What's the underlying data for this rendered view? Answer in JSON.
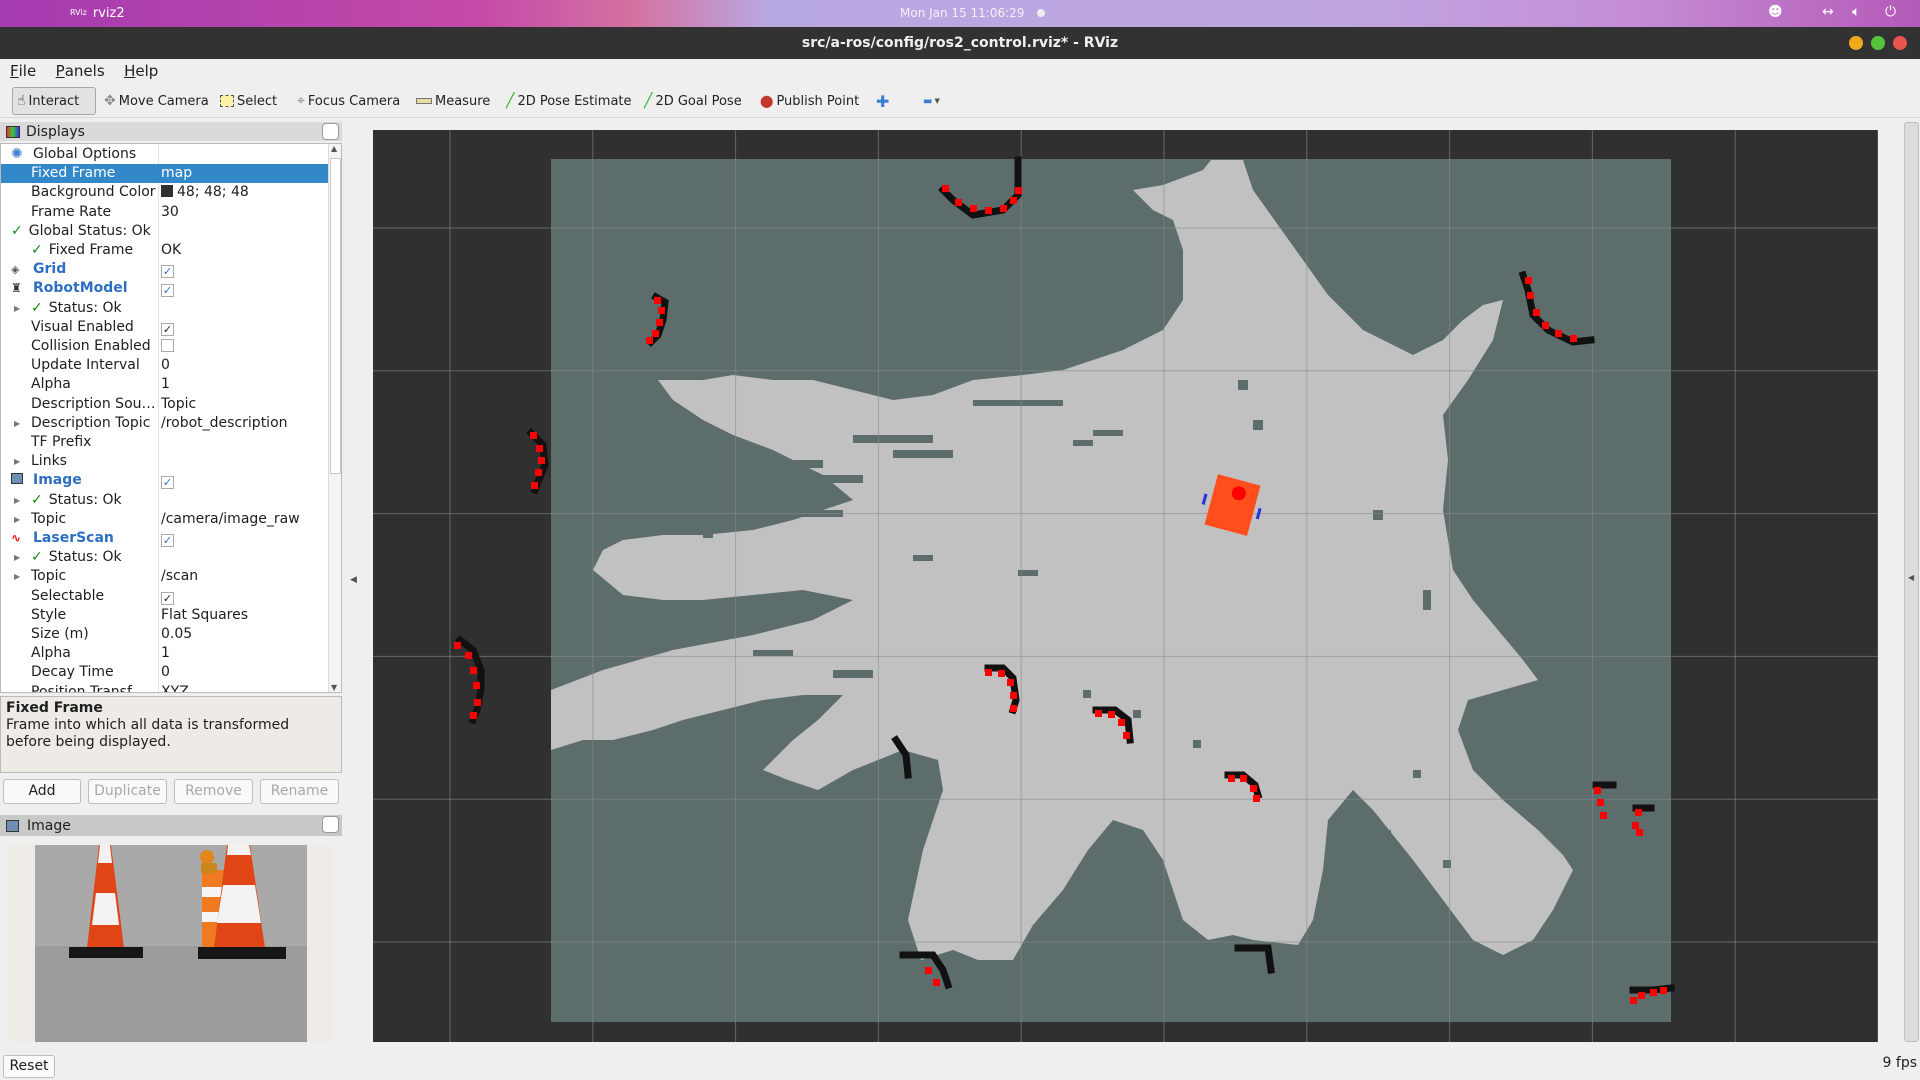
{
  "desktop": {
    "app_name": "rviz2",
    "app_badge": "RViz",
    "clock": "Mon Jan 15  11:06:29",
    "tray_icons": [
      "face-emoji-icon",
      "network-arrows-icon",
      "volume-icon",
      "power-icon"
    ]
  },
  "window": {
    "title": "src/a-ros/config/ros2_control.rviz* - RViz",
    "buttons": [
      {
        "name": "minimize",
        "color": "#f0a91c"
      },
      {
        "name": "maximize",
        "color": "#55c33a"
      },
      {
        "name": "close",
        "color": "#e9544c"
      }
    ]
  },
  "menu": [
    {
      "label": "File",
      "mnemonic": "F",
      "rest": "ile"
    },
    {
      "label": "Panels",
      "mnemonic": "P",
      "rest": "anels"
    },
    {
      "label": "Help",
      "mnemonic": "H",
      "rest": "elp"
    }
  ],
  "toolbar": [
    {
      "label": "Interact",
      "icon": "hand-pointer-icon",
      "glyph": "☝",
      "active": true
    },
    {
      "label": "Move Camera",
      "icon": "move-camera-icon",
      "glyph": "✥",
      "active": false
    },
    {
      "label": "Select",
      "icon": "select-rect-icon",
      "glyph": "▭",
      "active": false
    },
    {
      "label": "Focus Camera",
      "icon": "focus-camera-icon",
      "glyph": "⌖",
      "active": false
    },
    {
      "label": "Measure",
      "icon": "ruler-icon",
      "glyph": "▬",
      "active": false
    },
    {
      "label": "2D Pose Estimate",
      "icon": "pose-estimate-arrow-icon",
      "glyph": "╱",
      "active": false
    },
    {
      "label": "2D Goal Pose",
      "icon": "goal-pose-arrow-icon",
      "glyph": "╱",
      "active": false
    },
    {
      "label": "Publish Point",
      "icon": "map-pin-icon",
      "glyph": "●",
      "active": false
    },
    {
      "label": "",
      "icon": "add-tool-plus-icon",
      "glyph": "✚",
      "active": false
    },
    {
      "label": "",
      "icon": "remove-tool-minus-icon",
      "glyph": "▬",
      "active": false
    }
  ],
  "displays_panel": {
    "title": "Displays",
    "rows": [
      {
        "label": "Global Options",
        "value": "",
        "indent": 1,
        "icon": "gear-icon",
        "style": "plain"
      },
      {
        "label": "Fixed Frame",
        "value": "map",
        "indent": 2,
        "selected": true
      },
      {
        "label": "Background Color",
        "value": "48; 48; 48",
        "indent": 2,
        "swatch": "#303030"
      },
      {
        "label": "Frame Rate",
        "value": "30",
        "indent": 2
      },
      {
        "label": "Global Status: Ok",
        "value": "",
        "indent": 1,
        "check": true
      },
      {
        "label": "Fixed Frame",
        "value": "OK",
        "indent": 2,
        "check": true
      },
      {
        "label": "Grid",
        "value": "",
        "indent": 1,
        "icon": "grid-icon",
        "style": "blue",
        "checkbox": "checked-blue"
      },
      {
        "label": "RobotModel",
        "value": "",
        "indent": 1,
        "icon": "robot-model-icon",
        "style": "blue",
        "checkbox": "checked-blue"
      },
      {
        "label": "Status: Ok",
        "value": "",
        "indent": 2,
        "check": true,
        "expander": true
      },
      {
        "label": "Visual Enabled",
        "value": "",
        "indent": 2,
        "checkbox": "checked"
      },
      {
        "label": "Collision Enabled",
        "value": "",
        "indent": 2,
        "checkbox": "unchecked"
      },
      {
        "label": "Update Interval",
        "value": "0",
        "indent": 2
      },
      {
        "label": "Alpha",
        "value": "1",
        "indent": 2
      },
      {
        "label": "Description Sou…",
        "value": "Topic",
        "indent": 2
      },
      {
        "label": "Description Topic",
        "value": "/robot_description",
        "indent": 2,
        "expander": true
      },
      {
        "label": "TF Prefix",
        "value": "",
        "indent": 2
      },
      {
        "label": "Links",
        "value": "",
        "indent": 2,
        "expander": true
      },
      {
        "label": "Image",
        "value": "",
        "indent": 1,
        "icon": "image-icon",
        "style": "blue",
        "checkbox": "checked-blue"
      },
      {
        "label": "Status: Ok",
        "value": "",
        "indent": 2,
        "check": true,
        "expander": true
      },
      {
        "label": "Topic",
        "value": "/camera/image_raw",
        "indent": 2,
        "expander": true
      },
      {
        "label": "LaserScan",
        "value": "",
        "indent": 1,
        "icon": "laser-scan-icon",
        "style": "blue",
        "checkbox": "checked-blue"
      },
      {
        "label": "Status: Ok",
        "value": "",
        "indent": 2,
        "check": true,
        "expander": true
      },
      {
        "label": "Topic",
        "value": "/scan",
        "indent": 2,
        "expander": true
      },
      {
        "label": "Selectable",
        "value": "",
        "indent": 2,
        "checkbox": "checked"
      },
      {
        "label": "Style",
        "value": "Flat Squares",
        "indent": 2
      },
      {
        "label": "Size (m)",
        "value": "0.05",
        "indent": 2
      },
      {
        "label": "Alpha",
        "value": "1",
        "indent": 2
      },
      {
        "label": "Decay Time",
        "value": "0",
        "indent": 2
      },
      {
        "label": "Position Transf…",
        "value": "XYZ",
        "indent": 2
      }
    ],
    "description_title": "Fixed Frame",
    "description_text": "Frame into which all data is transformed before being displayed.",
    "buttons": {
      "add": "Add",
      "duplicate": "Duplicate",
      "remove": "Remove",
      "rename": "Rename"
    }
  },
  "image_panel": {
    "title": "Image",
    "reset_label": "Reset"
  },
  "view": {
    "fps": "9 fps",
    "background": "#303030",
    "map_unknown_color": "#5c6d6b",
    "map_free_color": "#c1c1c1",
    "obstacle_color": "#111111",
    "laser_color": "#ff0000",
    "robot_color": "#ff4e1c"
  }
}
